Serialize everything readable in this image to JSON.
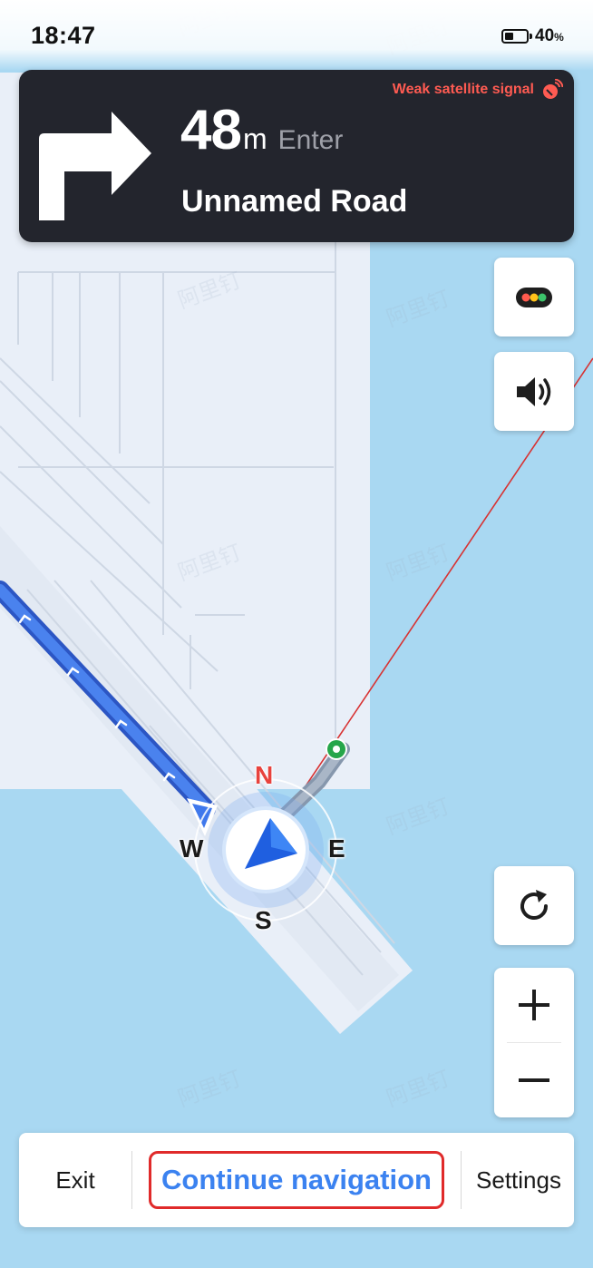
{
  "status_bar": {
    "time": "18:47",
    "battery_percent": "40",
    "battery_unit": "%"
  },
  "navigation": {
    "distance_value": "48",
    "distance_unit": "m",
    "action": "Enter",
    "road_name": "Unnamed Road",
    "signal_warning": "Weak satellite signal",
    "turn_direction": "right"
  },
  "compass": {
    "north": "N",
    "south": "S",
    "east": "E",
    "west": "W"
  },
  "map_controls": {
    "traffic_icon": "traffic-light-icon",
    "sound_icon": "speaker-icon",
    "refresh_icon": "refresh-icon",
    "zoom_in_icon": "plus-icon",
    "zoom_out_icon": "minus-icon"
  },
  "bottom_bar": {
    "exit_label": "Exit",
    "continue_label": "Continue navigation",
    "settings_label": "Settings"
  },
  "colors": {
    "banner_bg": "#23252d",
    "signal_warning": "#ff5b52",
    "continue_text": "#3b82f0",
    "highlight_border": "#e02a2a",
    "route_blue": "#3b6fe0",
    "water": "#a9d8f2",
    "land": "#e9eff8"
  }
}
